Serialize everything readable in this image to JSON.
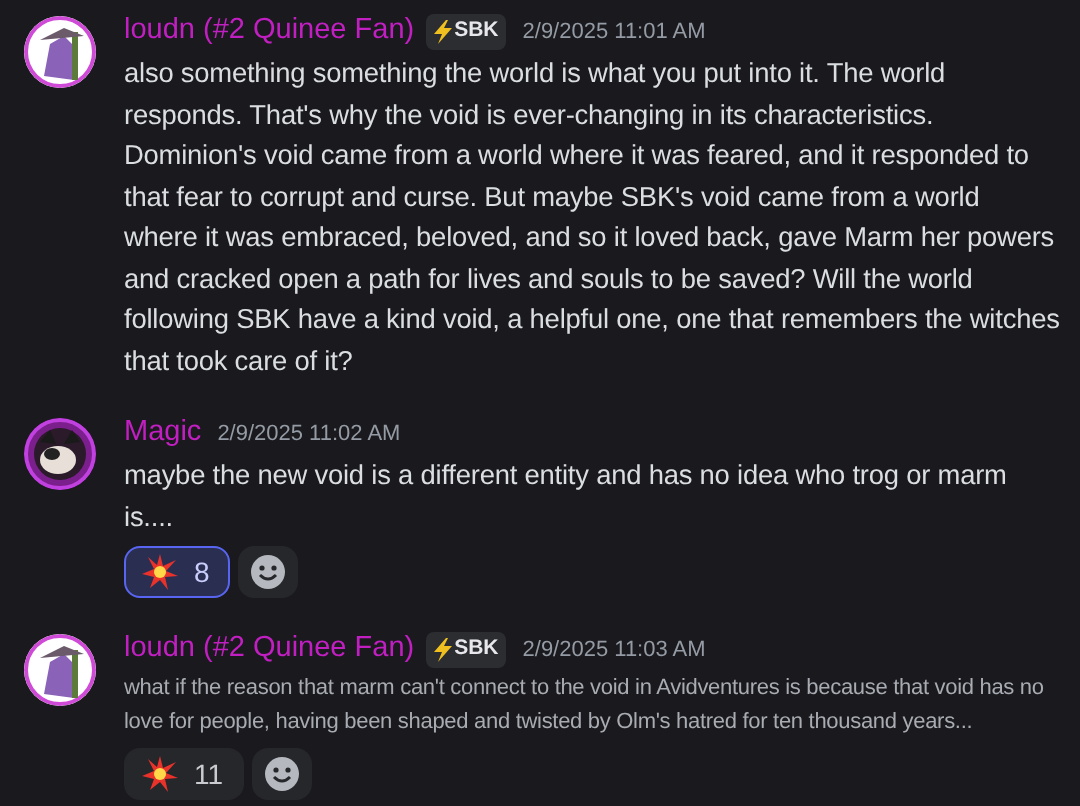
{
  "messages": [
    {
      "author": "loudn (#2 Quinee Fan)",
      "tag": "SBK",
      "timestamp": "2/9/2025 11:01 AM",
      "kind": "normal",
      "text": "also something something the world is what you put into it. The world responds. That's why the void is ever-changing in its characteristics. Dominion's void came from a world where it was feared, and it responded to that fear to corrupt and curse. But maybe SBK's void came from a world where it was embraced, beloved, and so it loved back, gave Marm her powers and cracked open a path for lives and souls to be saved? Will the world following SBK have a kind void, a helpful one, one that remembers the witches that took care of it?"
    },
    {
      "author": "Magic",
      "timestamp": "2/9/2025 11:02 AM",
      "kind": "normal",
      "text": "maybe the new void is a different entity and has no idea who trog or marm is....",
      "reactions": [
        {
          "count": "8",
          "selected": true
        }
      ]
    },
    {
      "author": "loudn (#2 Quinee Fan)",
      "tag": "SBK",
      "timestamp": "2/9/2025 11:03 AM",
      "kind": "subtext",
      "text": "what if the reason that marm can't connect to the void in Avidventures is because that void has no love for people, having been shaped and twisted by Olm's hatred for ten thousand years...",
      "reactions": [
        {
          "count": "11",
          "selected": false
        }
      ]
    }
  ]
}
